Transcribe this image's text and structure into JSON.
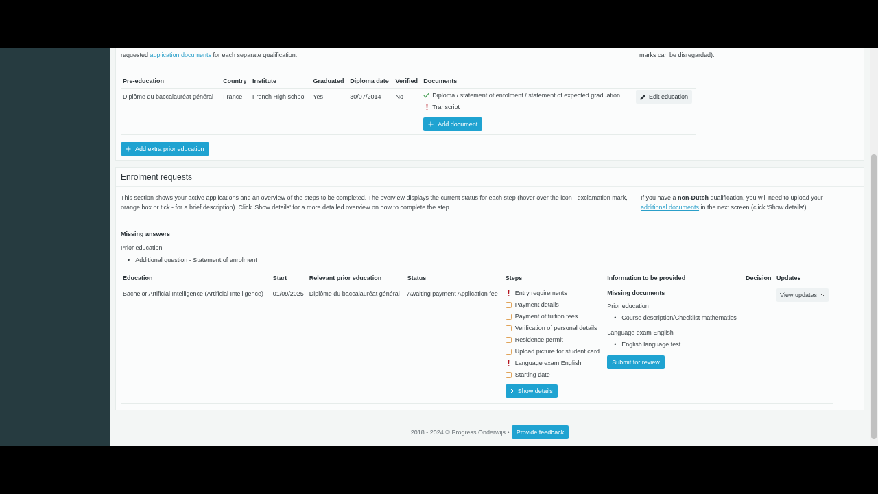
{
  "prior_section": {
    "intro": {
      "before": "requested ",
      "link": "application documents",
      "after": " for each separate qualification."
    },
    "side_note": "marks can be disregarded).",
    "columns": [
      "Pre-education",
      "Country",
      "Institute",
      "Graduated",
      "Diploma date",
      "Verified",
      "Documents"
    ],
    "rows": [
      {
        "cells": [
          "Diplôme du baccalauréat général",
          "France",
          "French High school",
          "Yes",
          "30/07/2014",
          "No"
        ],
        "documents": [
          {
            "kind": "ok",
            "label": "Diploma / statement of enrolment / statement of expected graduation"
          },
          {
            "kind": "missing",
            "label": "Transcript"
          }
        ],
        "add_document": "Add document",
        "edit": "Edit education"
      }
    ],
    "add_extra": "Add extra prior education"
  },
  "enrolment": {
    "title": "Enrolment requests",
    "description": "This section shows your active applications and an overview of the steps to be completed. The overview displays the current status for each step (hover over the icon - exclamation mark, orange box or tick - for a brief description). Click 'Show details' for a more detailed overview on how to complete the step.",
    "note": {
      "before": "If you have a **non-Dutch** qualification, you will need to upload your ",
      "link": "additional documents",
      "after": " in the next screen (click 'Show details')."
    },
    "missing_answers": {
      "title": "Missing answers",
      "group": "Prior education",
      "items": [
        {
          "bullet": "•",
          "text": "Additional question - Statement of enrolment"
        }
      ]
    },
    "columns": [
      "Education",
      "Start",
      "Relevant prior education",
      "Status",
      "Steps",
      "Information to be provided",
      "Decision",
      "Updates"
    ],
    "rows": [
      {
        "education": "Bachelor Artificial Intelligence (Artificial Intelligence)",
        "start": "01/09/2025",
        "prior": "Diplôme du baccalauréat général",
        "status": "Awaiting payment Application fee",
        "steps": [
          {
            "kind": "missing",
            "label": "Entry requirements"
          },
          {
            "kind": "pending",
            "label": "Payment details"
          },
          {
            "kind": "pending",
            "label": "Payment of tuition fees"
          },
          {
            "kind": "pending",
            "label": "Verification of personal details"
          },
          {
            "kind": "pending",
            "label": "Residence permit"
          },
          {
            "kind": "pending",
            "label": "Upload picture for student card"
          },
          {
            "kind": "missing",
            "label": "Language exam English"
          },
          {
            "kind": "pending",
            "label": "Starting date"
          }
        ],
        "show_details": "Show details",
        "info": {
          "title": "Missing documents",
          "groups": [
            {
              "title": "Prior education",
              "items": [
                {
                  "bullet": "•",
                  "text": "Course description/Checklist mathematics"
                }
              ]
            },
            {
              "title": "Language exam English",
              "items": [
                {
                  "bullet": "•",
                  "text": "English language test"
                }
              ]
            }
          ],
          "submit": "Submit for review"
        },
        "updates": "View updates"
      }
    ]
  },
  "footer": {
    "text": "2018 - 2024 © Progress Onderwijs •",
    "button": "Provide feedback"
  }
}
